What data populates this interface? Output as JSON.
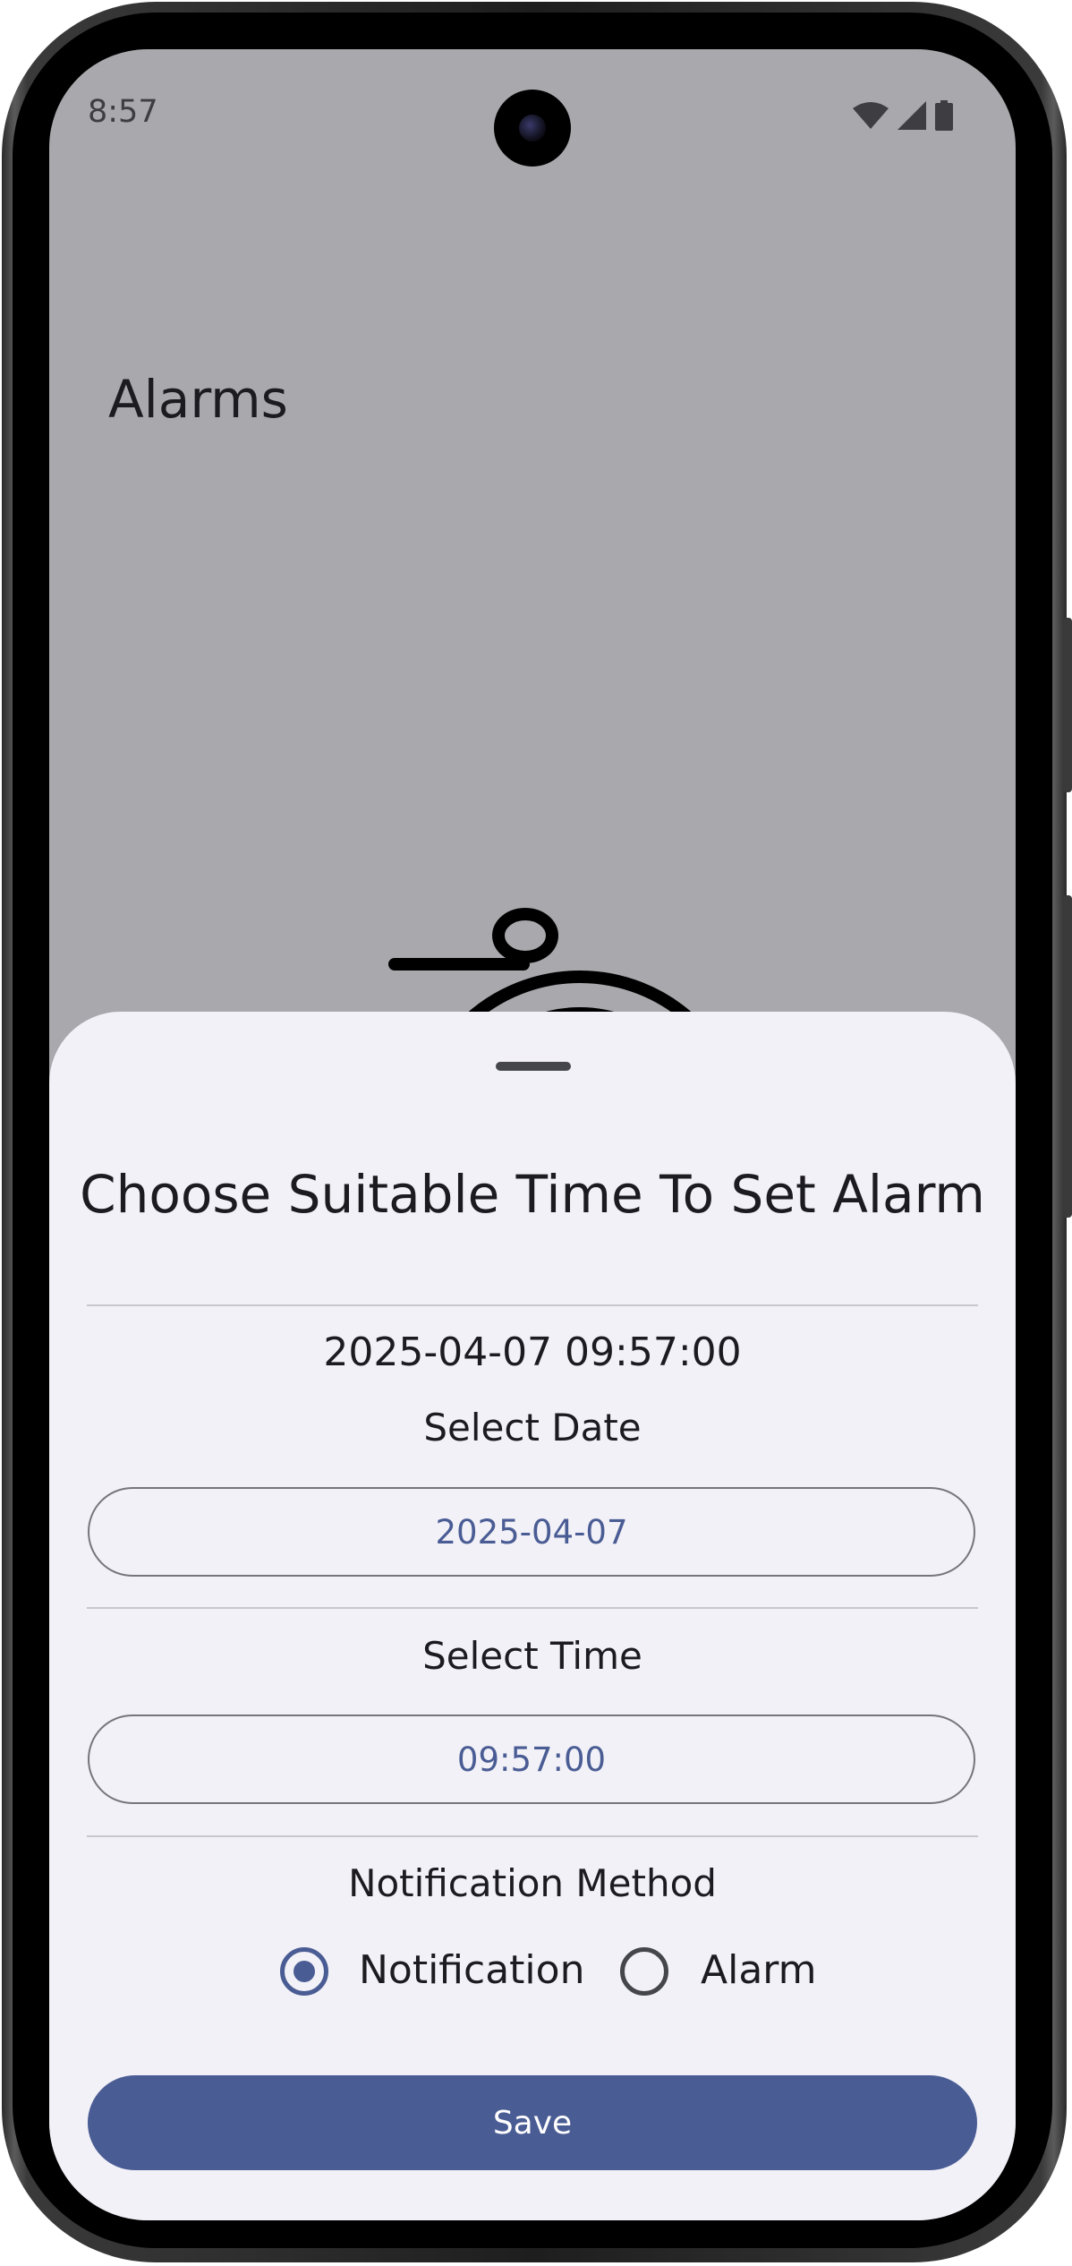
{
  "status_bar": {
    "time": "8:57",
    "icons": [
      "wifi-icon",
      "signal-icon",
      "battery-icon"
    ]
  },
  "page": {
    "title": "Alarms",
    "hero_icon": "stopwatch-icon"
  },
  "bottom_sheet": {
    "title": "Choose Suitable Time To Set Alarm",
    "selected_datetime": "2025-04-07 09:57:00",
    "date_label": "Select Date",
    "date_value": "2025-04-07",
    "time_label": "Select Time",
    "time_value": "09:57:00",
    "method_label": "Notification Method",
    "method_options": [
      {
        "label": "Notification",
        "selected": true
      },
      {
        "label": "Alarm",
        "selected": false
      }
    ],
    "save_label": "Save"
  },
  "colors": {
    "accent": "#4a5c94",
    "scrim_background": "#a9a8ad",
    "sheet_background": "#f2f1f7",
    "text_primary": "#1c1b20"
  }
}
